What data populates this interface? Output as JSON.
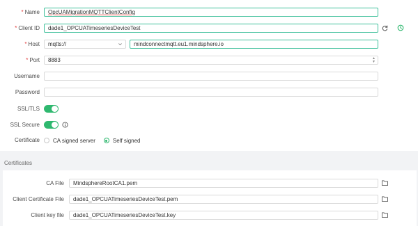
{
  "form": {
    "name": {
      "label": "Name",
      "required": true,
      "value": "OpcUAMigrationMQTTClientConfig"
    },
    "client_id": {
      "label": "Client ID",
      "required": true,
      "value": "dade1_OPCUATimeseriesDeviceTest"
    },
    "host": {
      "label": "Host",
      "required": true,
      "protocol": "mqtts://",
      "value": "mindconnectmqtt.eu1.mindsphere.io"
    },
    "port": {
      "label": "Port",
      "required": true,
      "value": "8883"
    },
    "username": {
      "label": "Username",
      "value": ""
    },
    "password": {
      "label": "Password",
      "value": ""
    },
    "ssl_tls": {
      "label": "SSL/TLS",
      "enabled": true
    },
    "ssl_secure": {
      "label": "SSL Secure",
      "enabled": true
    },
    "certificate": {
      "label": "Certificate",
      "options": [
        "CA signed server",
        "Self signed"
      ],
      "selected": "Self signed"
    }
  },
  "certificates": {
    "title": "Certificates",
    "ca_file": {
      "label": "CA File",
      "value": "MindsphereRootCA1.pem"
    },
    "client_cert": {
      "label": "Client Certificate File",
      "value": "dade1_OPCUATimeseriesDeviceTest.pem"
    },
    "client_key": {
      "label": "Client key file",
      "value": "dade1_OPCUATimeseriesDeviceTest.key"
    }
  },
  "icons": {
    "refresh": "refresh-icon",
    "history": "history-icon",
    "info": "info-icon",
    "folder": "folder-icon"
  },
  "colors": {
    "accent": "#2fb86f",
    "focus_border": "#3dbf9a",
    "required": "#e23d3d"
  }
}
